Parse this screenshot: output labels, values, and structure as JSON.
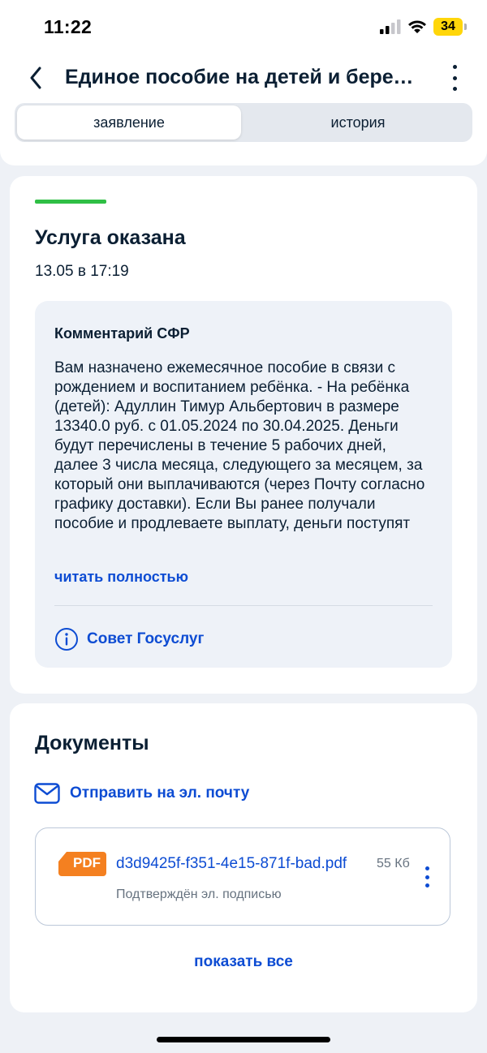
{
  "status_bar": {
    "time": "11:22",
    "battery": "34"
  },
  "header": {
    "title": "Единое пособие на детей и беременным женщинам",
    "tabs": [
      {
        "label": "заявление",
        "active": true
      },
      {
        "label": "история",
        "active": false
      }
    ]
  },
  "status_card": {
    "accent_color": "#2fbf45",
    "title": "Услуга оказана",
    "date": "13.05 в 17:19",
    "comment": {
      "title": "Комментарий СФР",
      "text": "Вам назначено ежемесячное пособие в связи с рождением и воспитанием ребёнка. - На ребёнка (детей): Адуллин Тимур Альбертович в размере 13340.0 руб. с 01.05.2024 по 30.04.2025. Деньги будут перечислены в течение 5 рабочих дней, далее 3 числа месяца, следующего за месяцем, за который они выплачиваются (через Почту согласно графику доставки). Если Вы ранее получали пособие и продлеваете выплату, деньги поступят",
      "read_more": "читать полностью",
      "tip_label": "Совет Госуслуг",
      "tip_icon": "info-icon"
    }
  },
  "documents": {
    "title": "Документы",
    "email_label": "Отправить на эл. почту",
    "email_icon": "mail-icon",
    "files": [
      {
        "type": "PDF",
        "name": "d3d9425f-f351-4e15-871f-bad.pdf",
        "size": "55 Кб",
        "subtitle": "Подтверждён эл. подписью"
      }
    ],
    "show_all": "показать все"
  },
  "colors": {
    "link": "#0d4cd3",
    "text": "#0b1f33",
    "pdf_badge": "#f48020"
  }
}
